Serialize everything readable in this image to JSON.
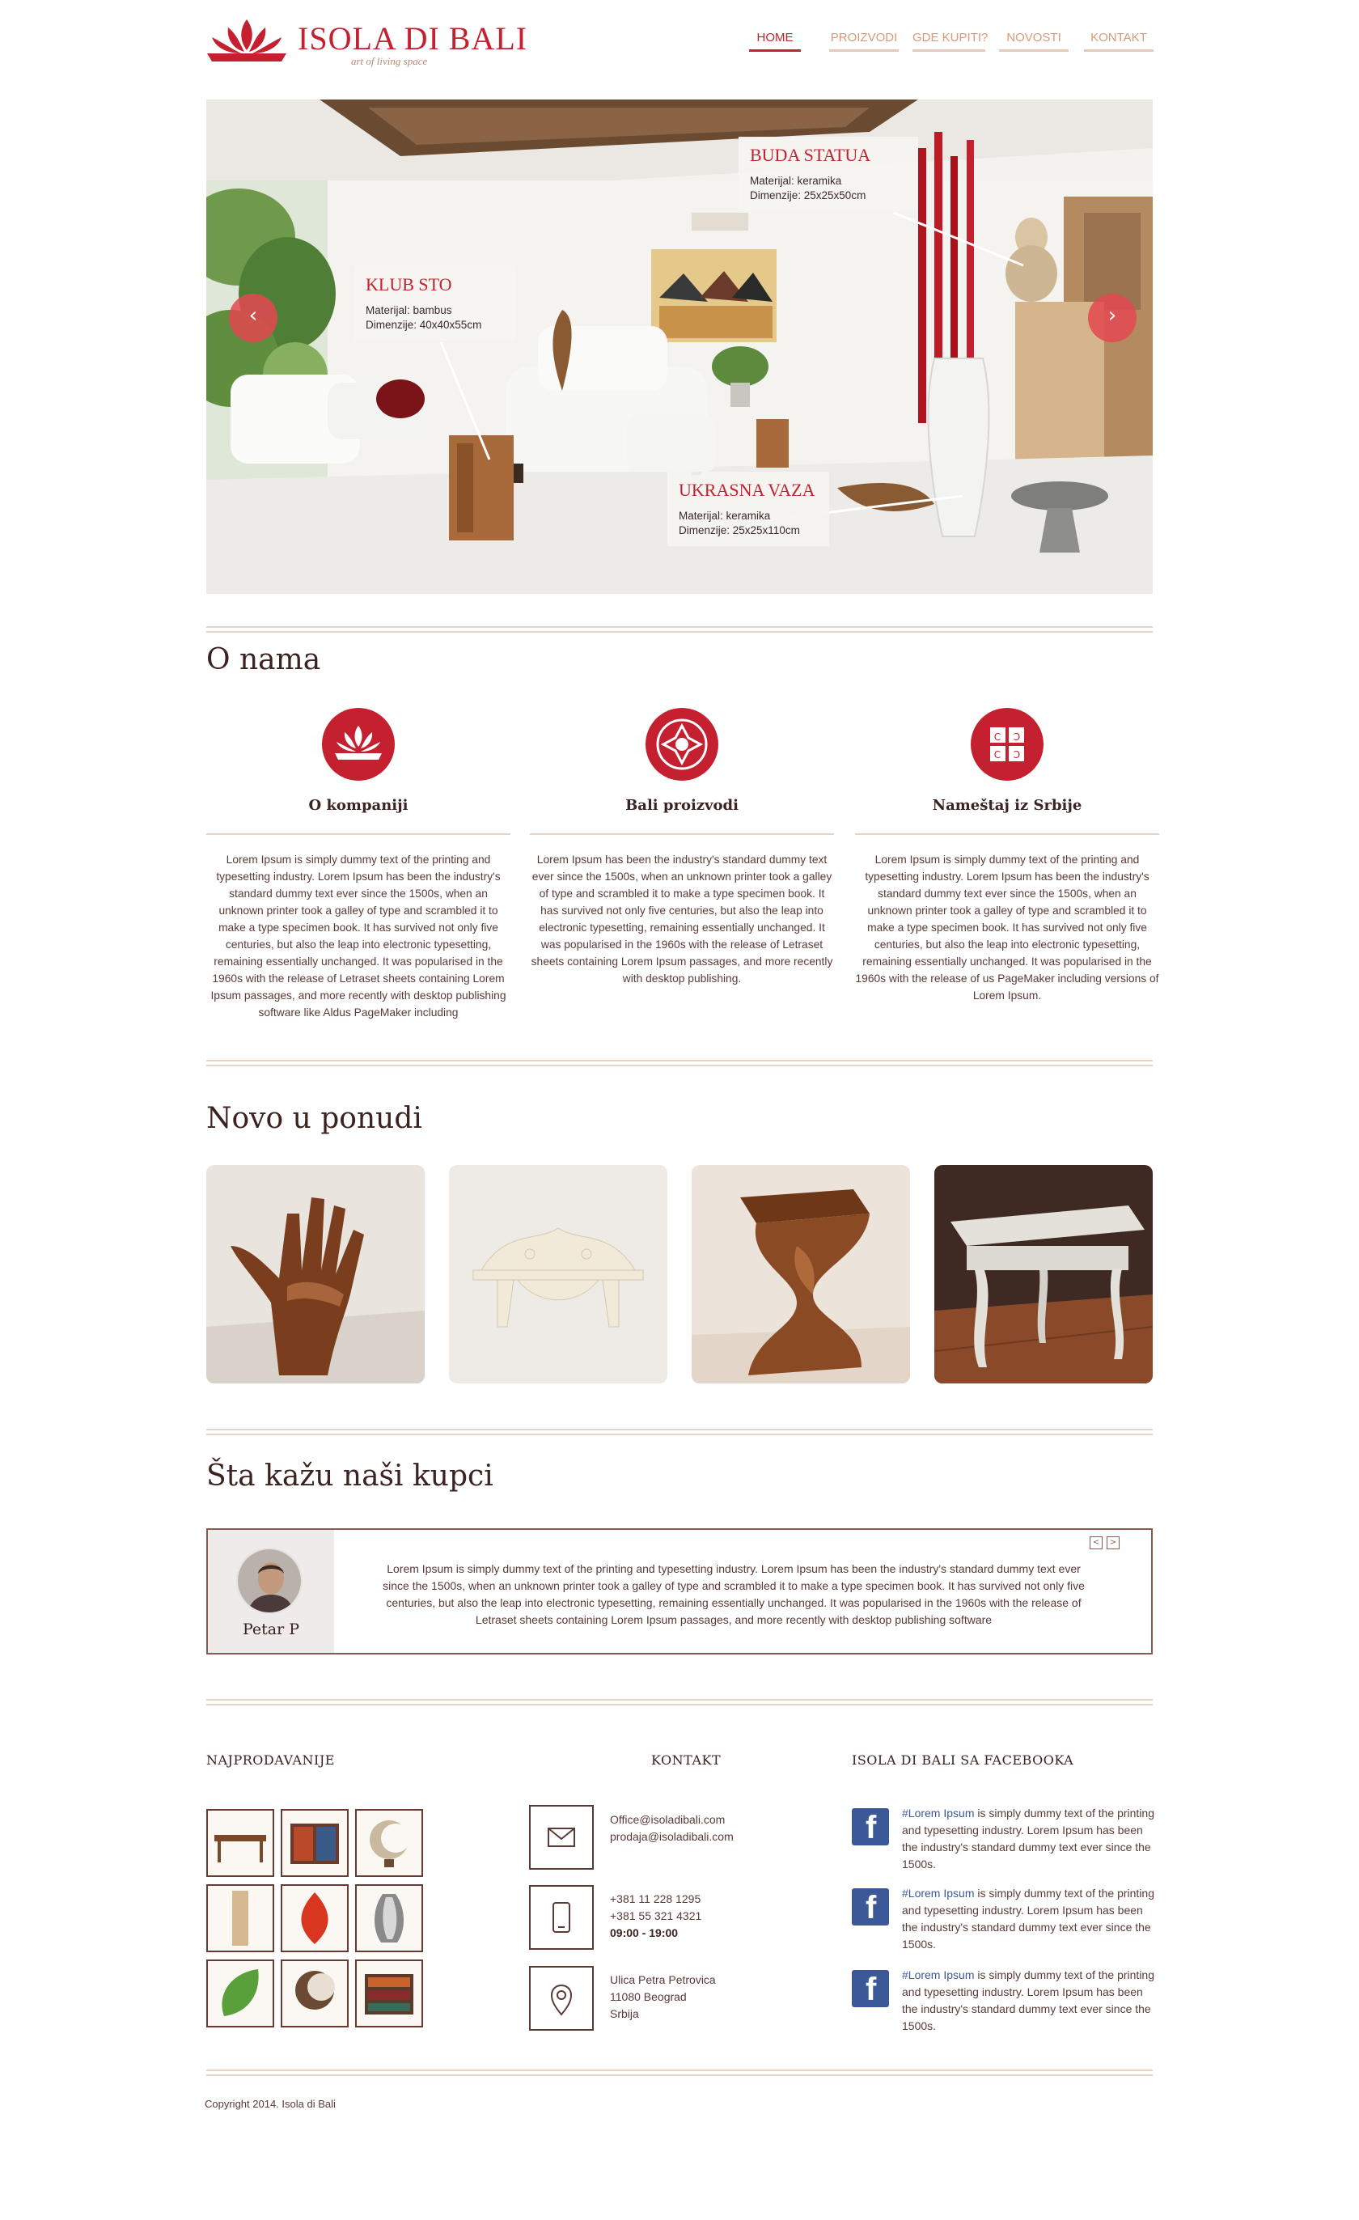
{
  "brand": {
    "name": "ISOLA DI BALI",
    "tagline": "art of living space",
    "accent": "#c4202f"
  },
  "nav": {
    "items": [
      "HOME",
      "PROIZVODI",
      "GDE KUPITI?",
      "NOVOSTI",
      "KONTAKT"
    ],
    "active": "HOME"
  },
  "hero": {
    "hotspots": [
      {
        "title": "KLUB STO",
        "material": "Materijal: bambus",
        "dimensions": "Dimenzije: 40x40x55cm"
      },
      {
        "title": "BUDA STATUA",
        "material": "Materijal: keramika",
        "dimensions": "Dimenzije: 25x25x50cm"
      },
      {
        "title": "UKRASNA VAZA",
        "material": "Materijal: keramika",
        "dimensions": "Dimenzije: 25x25x110cm"
      }
    ],
    "prev_icon": "chevron-left-icon",
    "next_icon": "chevron-right-icon"
  },
  "about": {
    "title": "O nama",
    "features": [
      {
        "icon": "lotus-icon",
        "title": "O kompaniji",
        "text": "Lorem Ipsum is simply dummy text of the printing and typesetting industry. Lorem Ipsum has been the industry's standard dummy text ever since the 1500s, when an unknown printer took a galley of type and scrambled it to make a type specimen book. It has survived not only five centuries, but also the leap into electronic typesetting, remaining essentially unchanged. It was popularised in the 1960s with the release of Letraset sheets containing Lorem Ipsum passages, and more recently with desktop publishing software like Aldus PageMaker including"
      },
      {
        "icon": "ornament-icon",
        "title": "Bali proizvodi",
        "text": "Lorem Ipsum has been the industry's standard dummy text ever since the 1500s, when an unknown printer took a galley of type and scrambled it to make a type specimen book. It has survived not only five centuries, but also the leap into electronic typesetting, remaining essentially unchanged. It was popularised in the 1960s with the release of Letraset sheets containing Lorem Ipsum passages, and more recently with desktop publishing."
      },
      {
        "icon": "serbian-cross-icon",
        "title": "Nameštaj iz Srbije",
        "text": "Lorem Ipsum is simply dummy text of the printing and typesetting industry. Lorem Ipsum has been the industry's standard dummy text ever since the 1500s, when an unknown printer took a galley of type and scrambled it to make a type specimen book. It has survived not only five centuries, but also the leap into electronic typesetting, remaining essentially unchanged. It was popularised in the 1960s with the release of us PageMaker including versions of Lorem Ipsum."
      }
    ]
  },
  "products": {
    "title": "Novo u ponudi",
    "items": [
      "wooden-hand-chair-image",
      "carved-wall-shelf-image",
      "twisted-wood-stool-image",
      "white-vintage-table-image"
    ]
  },
  "testimonials": {
    "title": "Šta kažu naši kupci",
    "name": "Petar P",
    "text": "Lorem Ipsum is simply dummy text of the printing and typesetting industry. Lorem Ipsum has been the industry's standard dummy text ever since the 1500s, when an unknown printer took a galley of type and scrambled it to make a type specimen book. It has survived not only five centuries, but also the leap into electronic typesetting, remaining essentially unchanged. It was popularised in the 1960s with the release of Letraset sheets containing Lorem Ipsum passages, and more recently with desktop publishing software",
    "prev": "<",
    "next": ">"
  },
  "footer": {
    "bestsellers_title": "NAJPRODAVANIJE",
    "contact_title": "KONTAKT",
    "facebook_title": "ISOLA DI BALI SA FACEBOOKA",
    "contact": {
      "email1": "Office@isoladibali.com",
      "email2": "prodaja@isoladibali.com",
      "phone1": "+381 11 228 1295",
      "phone2": "+381 55 321 4321",
      "hours": "09:00 - 19:00",
      "street": "Ulica Petra Petrovica",
      "city": "11080 Beograd",
      "country": "Srbija"
    },
    "facebook_posts": [
      {
        "tag": "#Lorem Ipsum",
        "text": " is simply dummy text of the printing and typesetting industry. Lorem Ipsum has been the industry's standard dummy text ever since the 1500s."
      },
      {
        "tag": "#Lorem Ipsum",
        "text": " is simply dummy text of the printing and typesetting industry. Lorem Ipsum has been the industry's standard dummy text ever since the 1500s."
      },
      {
        "tag": "#Lorem Ipsum",
        "text": " is simply dummy text of the printing and typesetting industry. Lorem Ipsum has been the industry's standard dummy text ever since the 1500s."
      }
    ],
    "copyright": "Copyright 2014. Isola di Bali"
  }
}
